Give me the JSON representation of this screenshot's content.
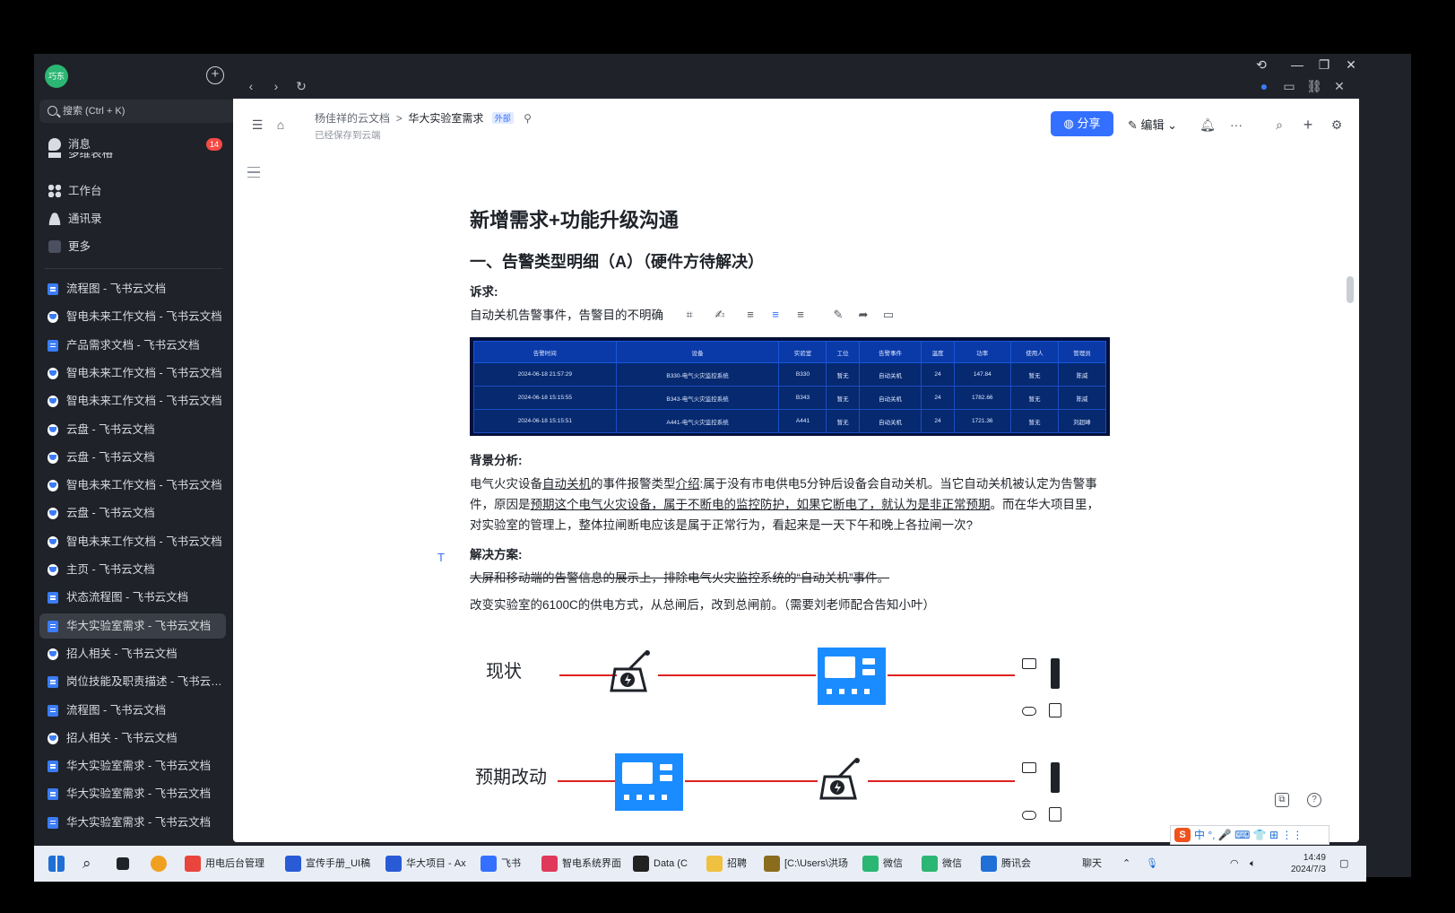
{
  "sidebar": {
    "avatar_text": "巧东",
    "search_label": "搜索 (Ctrl + K)",
    "nav": [
      {
        "label": "消息",
        "badge": "14"
      },
      {
        "label": "多维表格"
      },
      {
        "label": "工作台"
      },
      {
        "label": "通讯录"
      },
      {
        "label": "更多"
      }
    ],
    "docs": [
      {
        "label": "流程图 - 飞书云文档",
        "icon": "doc"
      },
      {
        "label": "智电未来工作文档 - 飞书云文档",
        "icon": "chrome"
      },
      {
        "label": "产品需求文档 - 飞书云文档",
        "icon": "doc"
      },
      {
        "label": "智电未来工作文档 - 飞书云文档",
        "icon": "chrome"
      },
      {
        "label": "智电未来工作文档 - 飞书云文档",
        "icon": "chrome"
      },
      {
        "label": "云盘 - 飞书云文档",
        "icon": "chrome"
      },
      {
        "label": "云盘 - 飞书云文档",
        "icon": "chrome"
      },
      {
        "label": "智电未来工作文档 - 飞书云文档",
        "icon": "chrome"
      },
      {
        "label": "云盘 - 飞书云文档",
        "icon": "chrome"
      },
      {
        "label": "智电未来工作文档 - 飞书云文档",
        "icon": "chrome"
      },
      {
        "label": "主页 - 飞书云文档",
        "icon": "chrome"
      },
      {
        "label": "状态流程图 - 飞书云文档",
        "icon": "doc"
      },
      {
        "label": "华大实验室需求 - 飞书云文档",
        "icon": "doc"
      },
      {
        "label": "招人相关 - 飞书云文档",
        "icon": "chrome"
      },
      {
        "label": "岗位技能及职责描述 - 飞书云…",
        "icon": "doc"
      },
      {
        "label": "流程图 - 飞书云文档",
        "icon": "doc"
      },
      {
        "label": "招人相关 - 飞书云文档",
        "icon": "chrome"
      },
      {
        "label": "华大实验室需求 - 飞书云文档",
        "icon": "doc"
      },
      {
        "label": "华大实验室需求 - 飞书云文档",
        "icon": "doc"
      },
      {
        "label": "华大实验室需求 - 飞书云文档",
        "icon": "doc"
      }
    ]
  },
  "header": {
    "breadcrumb_parent": "杨佳祥的云文档",
    "breadcrumb_current": "华大实验室需求",
    "external_tag": "外部",
    "save_status": "已经保存到云端",
    "share_label": "分享",
    "edit_label": "编辑"
  },
  "document": {
    "title": "新增需求+功能升级沟通",
    "section1": "一、告警类型明细（A）（硬件方待解决）",
    "appeal_label": "诉求",
    "appeal_text": "自动关机告警事件，告警目的不明确",
    "background_label": "背景分析",
    "background_p1": "电气火灾设备",
    "background_u1": "自动关机",
    "background_p2": "的事件报警类型",
    "background_u2": "介绍",
    "background_p3": ":属于没有市电供电5分钟后设备会自动关机。当它自动关机被认定为告警事件，原因是",
    "background_u3": "预期这个电气火灾设备，属于不断电的监控防护，如果它断电了，就认为是非正常预期",
    "background_p4": "。而在华大项目里，对实验室的管理上，整体拉闸断电应该是属于正常行为，看起来是一天下午和晚上各拉闸一次?",
    "solution_label": "解决方案",
    "solution_strike": "大屏和移动端的告警信息的展示上，排除电气火灾监控系统的“自动关机”事件。",
    "solution_text": "改变实验室的6100C的供电方式，从总闸后，改到总闸前。（需要刘老师配合告知小叶）",
    "diagram_current": "现状",
    "diagram_expected": "预期改动"
  },
  "alarm_table": {
    "headers": [
      "告警时间",
      "设备",
      "实验室",
      "工位",
      "告警事件",
      "温度",
      "功率",
      "使用人",
      "管理员"
    ],
    "rows": [
      [
        "2024-06-18 21:57:29",
        "B330-电气火灾监控系统",
        "B330",
        "暂无",
        "自动关机",
        "24",
        "147.84",
        "暂无",
        "陈威"
      ],
      [
        "2024-06-18 15:15:55",
        "B343-电气火灾监控系统",
        "B343",
        "暂无",
        "自动关机",
        "24",
        "1782.66",
        "暂无",
        "陈威"
      ],
      [
        "2024-06-18 15:15:51",
        "A441-电气火灾监控系统",
        "A441",
        "暂无",
        "自动关机",
        "24",
        "1721.36",
        "暂无",
        "刘超峰"
      ]
    ]
  },
  "taskbar": {
    "items": [
      "用电后台管理",
      "宣传手册_UI稿",
      "华大项目 - Ax",
      "飞书",
      "智电系统界面",
      "Data (C",
      "招聘",
      "[C:\\Users\\洪玚",
      "微信",
      "微信",
      "腾讯会",
      "聊天"
    ],
    "time": "14:49",
    "date": "2024/7/3",
    "ime_text": "中 °, 🎤 ⌨ 👕 ⊞ ⋮⋮"
  }
}
